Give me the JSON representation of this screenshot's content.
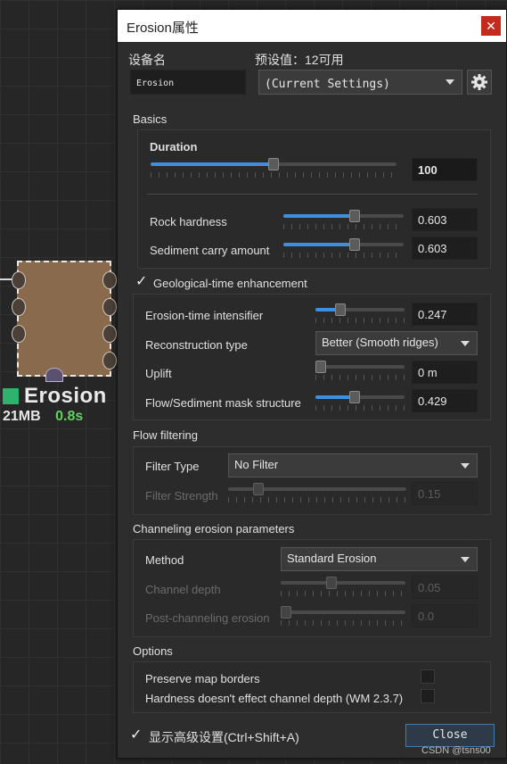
{
  "node": {
    "name": "Erosion",
    "memory": "21MB",
    "time": "0.8s",
    "color": "#2fb36c"
  },
  "dialog": {
    "title": "Erosion属性",
    "close_icon": "close-icon",
    "device_name_label": "设备名",
    "device_name_value": "Erosion",
    "preset_label": "预设值：12可用",
    "preset_value": "(Current Settings)",
    "settings_icon": "gear-icon"
  },
  "basics": {
    "header": "Basics",
    "duration": {
      "label": "Duration",
      "value": "100",
      "level": 0.5
    },
    "rock_hardness": {
      "label": "Rock hardness",
      "value": "0.603",
      "level": 0.603
    },
    "sediment_carry": {
      "label": "Sediment carry amount",
      "value": "0.603",
      "level": 0.603
    }
  },
  "geo": {
    "checkbox_label": "Geological-time enhancement",
    "checked": true,
    "intensifier": {
      "label": "Erosion-time intensifier",
      "value": "0.247",
      "level": 0.247
    },
    "reconstruction": {
      "label": "Reconstruction type",
      "value": "Better (Smooth ridges)"
    },
    "uplift": {
      "label": "Uplift",
      "value": "0 m",
      "level": 0.0
    },
    "flow_mask": {
      "label": "Flow/Sediment mask structure",
      "value": "0.429",
      "level": 0.429
    }
  },
  "flow": {
    "header": "Flow filtering",
    "filter_type": {
      "label": "Filter Type",
      "value": "No Filter"
    },
    "filter_strength": {
      "label": "Filter Strength",
      "value": "0.15",
      "level": 0.15
    }
  },
  "channel": {
    "header": "Channeling erosion parameters",
    "method": {
      "label": "Method",
      "value": "Standard Erosion"
    },
    "depth": {
      "label": "Channel depth",
      "value": "0.05",
      "level": 0.4
    },
    "post": {
      "label": "Post-channeling erosion",
      "value": "0.0",
      "level": 0.0
    }
  },
  "options": {
    "header": "Options",
    "preserve": {
      "label": "Preserve map borders",
      "checked": false
    },
    "hardness": {
      "label": "Hardness doesn't effect channel depth (WM 2.3.7)",
      "checked": false
    }
  },
  "footer": {
    "advanced_label": "显示高级设置(Ctrl+Shift+A)",
    "advanced_checked": true,
    "close_label": "Close",
    "watermark": "CSDN @tsns00"
  },
  "colors": {
    "accent": "#3f8fe0",
    "close_red": "#c42b1c",
    "node_time": "#5fd35f"
  }
}
